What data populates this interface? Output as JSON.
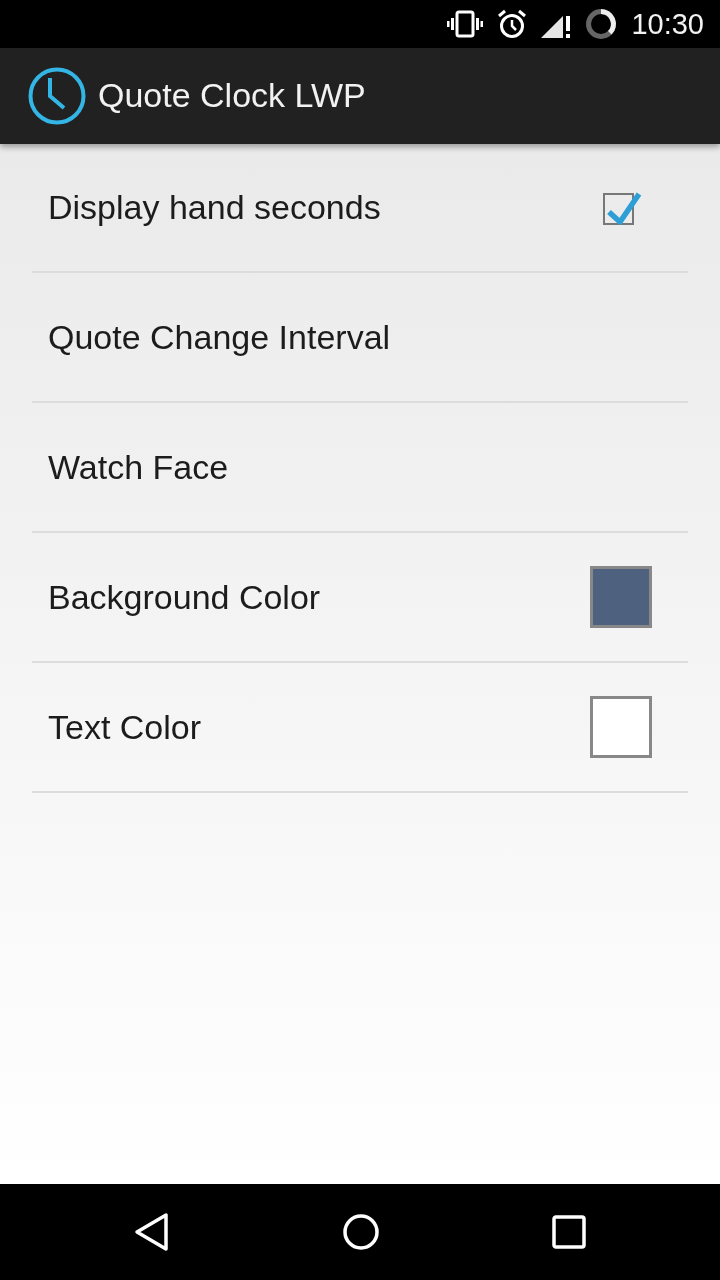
{
  "status_bar": {
    "time": "10:30"
  },
  "app_bar": {
    "title": "Quote Clock LWP"
  },
  "preferences": [
    {
      "kind": "checkbox",
      "label": "Display hand seconds",
      "checked": true
    },
    {
      "kind": "plain",
      "label": "Quote Change Interval"
    },
    {
      "kind": "plain",
      "label": "Watch Face"
    },
    {
      "kind": "color",
      "label": "Background Color",
      "color": "#4e6280"
    },
    {
      "kind": "color",
      "label": "Text Color",
      "color": "#ffffff"
    }
  ]
}
